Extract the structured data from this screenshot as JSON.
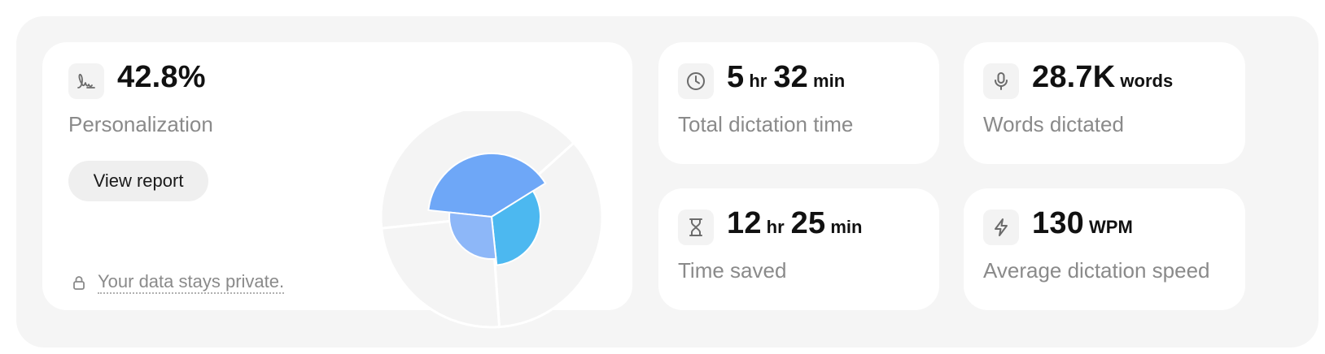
{
  "personalization": {
    "value": "42.8%",
    "label": "Personalization",
    "button_label": "View report",
    "privacy_text": "Your data stays private.",
    "icon": "signature-icon",
    "chart": {
      "type": "polar-area",
      "background_color": "#f4f4f4",
      "segment_colors": [
        "#6ea7f7",
        "#4cb8f0",
        "#8db7f8"
      ]
    }
  },
  "stats": [
    {
      "icon": "clock-icon",
      "parts": [
        {
          "num": "5",
          "unit": "hr"
        },
        {
          "num": "32",
          "unit": "min"
        }
      ],
      "label": "Total dictation time"
    },
    {
      "icon": "microphone-icon",
      "parts": [
        {
          "num": "28.7K",
          "unit": "words"
        }
      ],
      "label": "Words dictated"
    },
    {
      "icon": "hourglass-icon",
      "parts": [
        {
          "num": "12",
          "unit": "hr"
        },
        {
          "num": "25",
          "unit": "min"
        }
      ],
      "label": "Time saved"
    },
    {
      "icon": "lightning-icon",
      "parts": [
        {
          "num": "130",
          "unit": "WPM"
        }
      ],
      "label": "Average dictation speed"
    }
  ],
  "colors": {
    "panel_bg": "#f5f5f5",
    "card_bg": "#ffffff",
    "primary_text": "#111111",
    "secondary_text": "#8a8a8a",
    "icon_bg": "#f3f3f3"
  }
}
